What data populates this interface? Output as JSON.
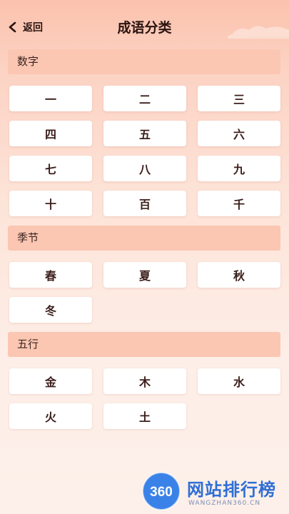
{
  "header": {
    "back_label": "返回",
    "title": "成语分类"
  },
  "sections": [
    {
      "title": "数字",
      "items": [
        "一",
        "二",
        "三",
        "四",
        "五",
        "六",
        "七",
        "八",
        "九",
        "十",
        "百",
        "千"
      ]
    },
    {
      "title": "季节",
      "items": [
        "春",
        "夏",
        "秋",
        "冬"
      ]
    },
    {
      "title": "五行",
      "items": [
        "金",
        "木",
        "水",
        "火",
        "土"
      ]
    }
  ],
  "watermark": {
    "logo_text": "360",
    "text": "网站排行榜",
    "subtext": "WANGZHAN360.CN"
  },
  "colors": {
    "section_bg": "#fbc6b2",
    "accent_blue": "#2f6fd6"
  }
}
